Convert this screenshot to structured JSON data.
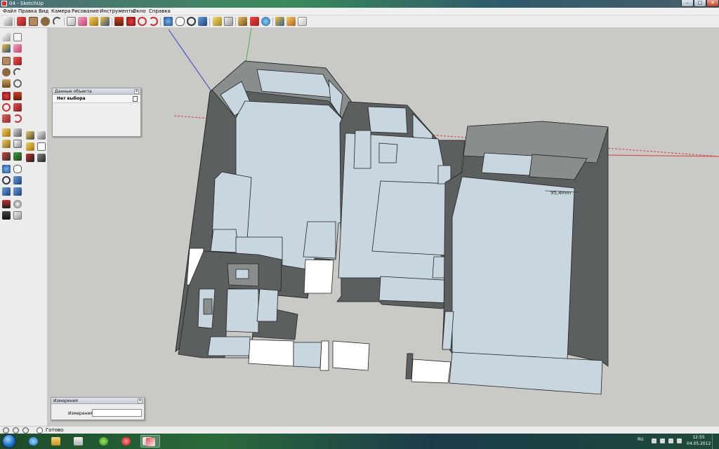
{
  "window": {
    "title": "04 - SketchUp",
    "controls": {
      "minimize": "–",
      "maximize": "□",
      "close": "✕"
    }
  },
  "menu": [
    "Файл",
    "Правка",
    "Вид",
    "Камера",
    "Рисование",
    "Инструменты",
    "Окно",
    "Справка"
  ],
  "toolbar": {
    "icons": [
      "select-tool",
      "pencil-tool",
      "rectangle-tool",
      "circle-tool",
      "arc-tool",
      "make-component-tool",
      "eraser-tool",
      "tape-measure-tool",
      "paint-bucket-tool",
      "push-pull-tool",
      "move-tool",
      "rotate-tool",
      "offset-tool",
      "orbit-tool",
      "pan-tool",
      "zoom-tool",
      "zoom-extents-tool",
      "previous-view-tool",
      "next-view-tool",
      "get-models-tool",
      "share-model-tool",
      "share-component-tool",
      "google-earth-tool",
      "styles-tool",
      "section-plane-tool",
      "component-browser-tool"
    ]
  },
  "entity_info": {
    "title": "Данные объекта",
    "close": "x",
    "selection": "Нет выбора"
  },
  "measurements": {
    "title": "Измерения",
    "close": "x",
    "label": "Измерения",
    "value": ""
  },
  "viewport": {
    "dimension_label": "95,4mm"
  },
  "status": {
    "text": "Готово"
  },
  "taskbar": {
    "apps": [
      "internet-explorer",
      "file-explorer",
      "media-player",
      "icq",
      "opera",
      "sketchup",
      "sketchup-active"
    ],
    "language": "RU",
    "time": "12:55",
    "date": "04.05.2012"
  },
  "colors": {
    "floor": "#c8d6e0",
    "wall_top": "#ffffff",
    "wall_dark": "#5c5f60",
    "wall_mid": "#8a8d8e",
    "background": "#c9c9c5",
    "axis_red": "#d84040",
    "axis_green": "#50b050",
    "axis_blue": "#4040c8"
  }
}
